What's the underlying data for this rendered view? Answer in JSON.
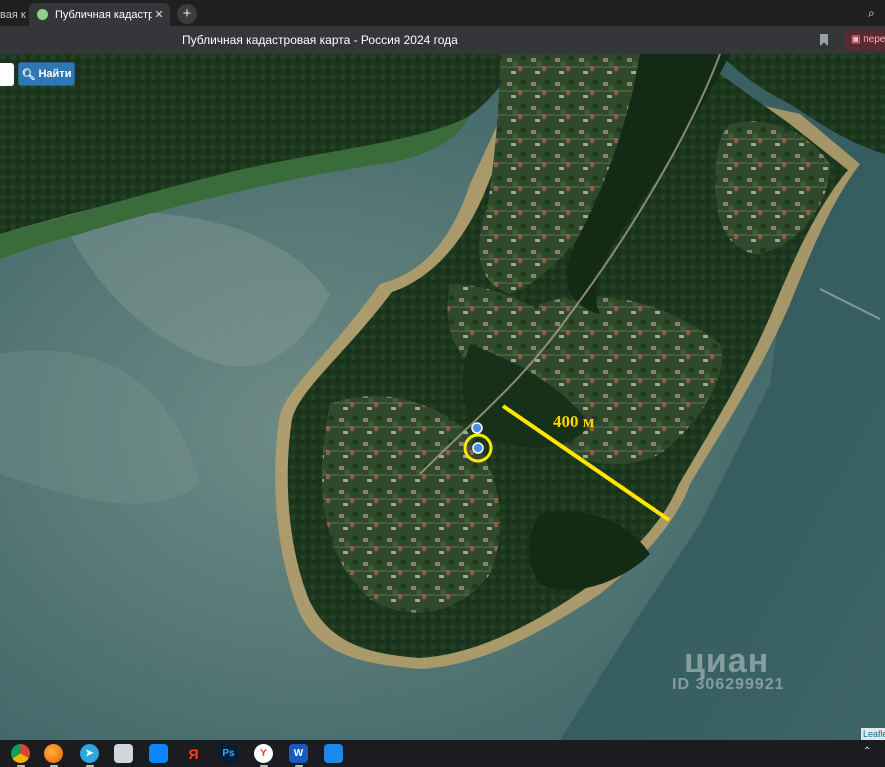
{
  "browser": {
    "tabs": [
      {
        "label": "вая к"
      },
      {
        "label": "Публичная кадастрова"
      }
    ],
    "page_title": "Публичная кадастровая карта - Россия 2024 года",
    "extension_label": "пере"
  },
  "map_toolbar": {
    "search_button_label": "Найти",
    "search_value": ""
  },
  "map_overlay": {
    "distance_label": "400 м",
    "watermark_brand": "циан",
    "watermark_id": "ID 306299921",
    "attribution": "Leaflet"
  },
  "taskbar": {
    "apps": [
      {
        "name": "chrome-icon",
        "glyph": "",
        "color": "#db4437"
      },
      {
        "name": "firefox-icon",
        "glyph": "",
        "color": "#ff7139"
      },
      {
        "name": "telegram-icon",
        "glyph": "",
        "color": "#2ca5e0"
      },
      {
        "name": "paint-icon",
        "glyph": "",
        "color": "#9aa0a6"
      },
      {
        "name": "windows-store-icon",
        "glyph": "",
        "color": "#0a84ff"
      },
      {
        "name": "yandex-icon",
        "glyph": "Я",
        "color": "#fc3f1d"
      },
      {
        "name": "photoshop-icon",
        "glyph": "Ps",
        "color": "#001e36"
      },
      {
        "name": "yandex-browser-icon",
        "glyph": "Y",
        "color": "#fc3f1d"
      },
      {
        "name": "word-icon",
        "glyph": "W",
        "color": "#185abd"
      },
      {
        "name": "app-icon",
        "glyph": "",
        "color": "#1e88e5"
      }
    ]
  },
  "colors": {
    "water": "#3c6e72",
    "forest": "#1d3a1f",
    "shore": "#b59a62",
    "measure_line": "#ffe600",
    "marker": "#4a90e2"
  }
}
